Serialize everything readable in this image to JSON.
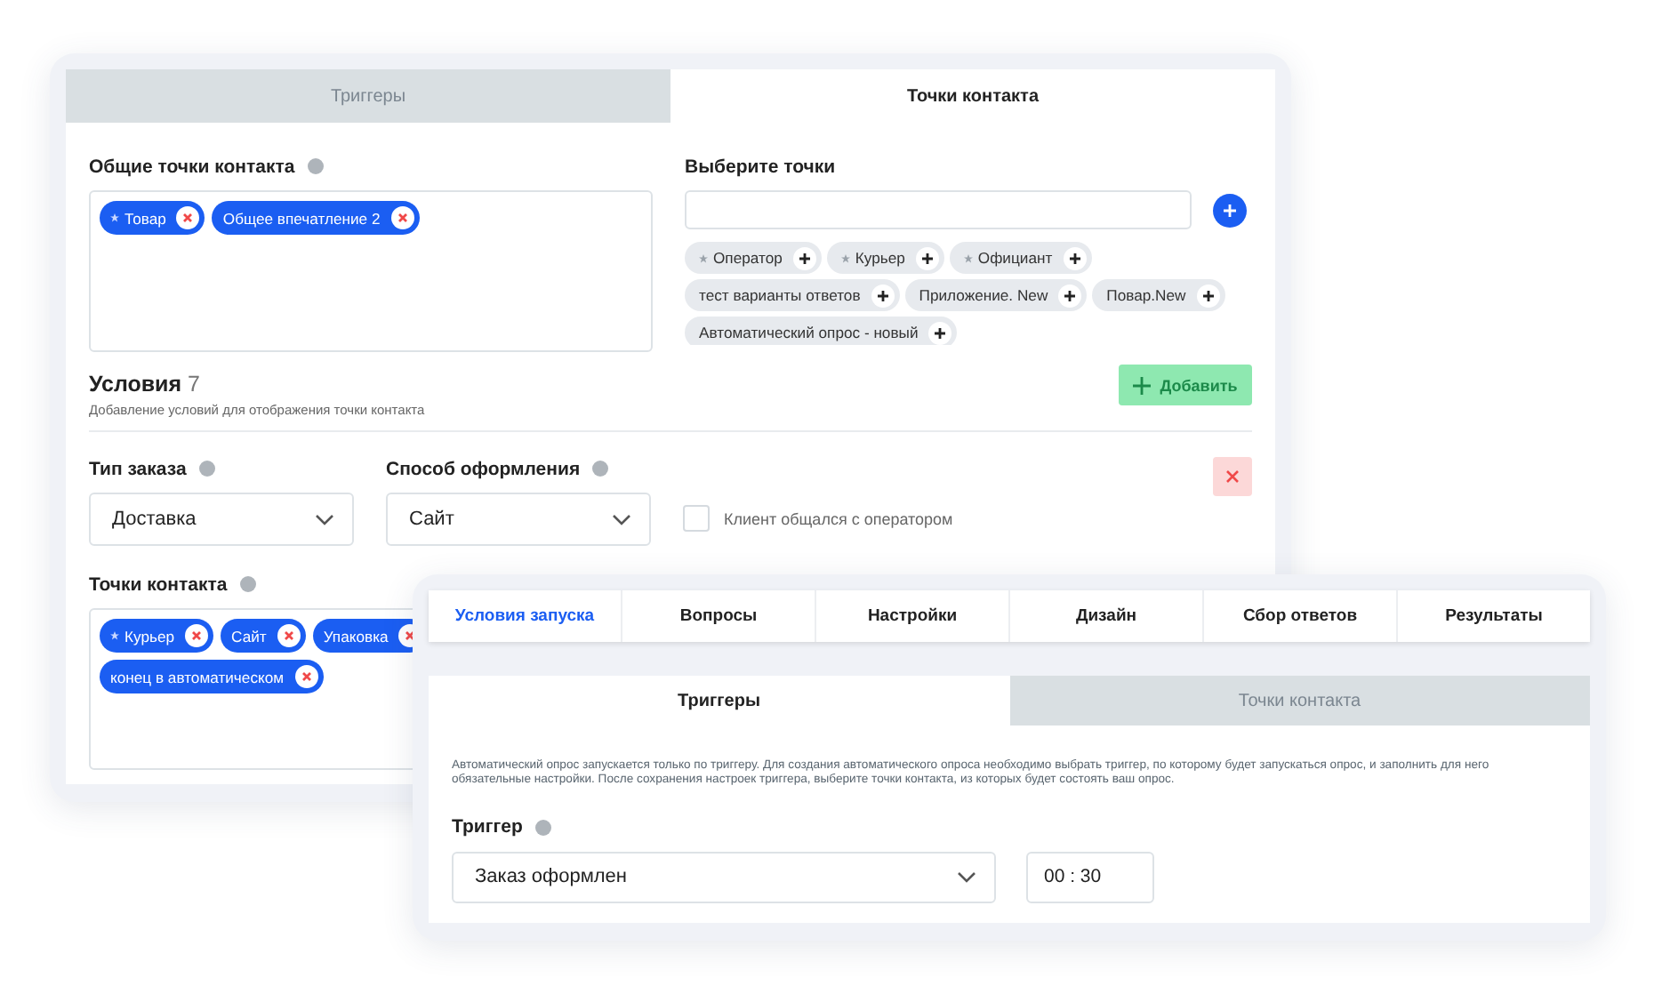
{
  "back_window": {
    "tabs": [
      {
        "label": "Триггеры",
        "selected": false
      },
      {
        "label": "Точки контакта",
        "selected": true
      }
    ],
    "common_points": {
      "label": "Общие точки контакта",
      "chips": [
        {
          "label": "Товар",
          "starred": true
        },
        {
          "label": "Общее впечатление 2",
          "starred": false
        }
      ]
    },
    "choose_points": {
      "label": "Выберите точки",
      "options": [
        {
          "label": "Оператор",
          "starred": true
        },
        {
          "label": "Курьер",
          "starred": true
        },
        {
          "label": "Официант",
          "starred": true
        },
        {
          "label": "тест варианты ответов",
          "starred": false
        },
        {
          "label": "Приложение. New",
          "starred": false
        },
        {
          "label": "Повар.New",
          "starred": false
        },
        {
          "label": "Автоматический опрос - новый",
          "starred": false
        }
      ]
    },
    "conditions": {
      "title": "Условия",
      "count": "7",
      "subtitle": "Добавление условий для отображения точки контакта",
      "add_button": "Добавить"
    },
    "condition_fields": [
      {
        "label": "Тип заказа",
        "value": "Доставка"
      },
      {
        "label": "Способ оформления",
        "value": "Сайт"
      }
    ],
    "operator_checkbox": {
      "label": "Клиент общался с оператором",
      "checked": false
    },
    "contact_points": {
      "label": "Точки контакта",
      "chips": [
        {
          "label": "Курьер",
          "starred": true
        },
        {
          "label": "Сайт",
          "starred": false
        },
        {
          "label": "Упаковка",
          "starred": false
        },
        {
          "label": "конец в автоматическом",
          "starred": false
        }
      ]
    }
  },
  "front_window": {
    "nav": [
      {
        "label": "Условия запуска",
        "selected": true
      },
      {
        "label": "Вопросы",
        "selected": false
      },
      {
        "label": "Настройки",
        "selected": false
      },
      {
        "label": "Дизайн",
        "selected": false
      },
      {
        "label": "Сбор ответов",
        "selected": false
      },
      {
        "label": "Результаты",
        "selected": false
      }
    ],
    "tabs": [
      {
        "label": "Триггеры",
        "selected": true
      },
      {
        "label": "Точки контакта",
        "selected": false
      }
    ],
    "description": "Автоматический опрос запускается только по триггеру. Для создания автоматического опроса необходимо выбрать триггер, по которому будет запускаться опрос, и заполнить для него обязательные настройки. После сохранения настроек триггера, выберите точки контакта, из которых будет состоять ваш опрос.",
    "trigger": {
      "label": "Триггер",
      "value": "Заказ оформлен",
      "time": "00 : 30"
    }
  }
}
